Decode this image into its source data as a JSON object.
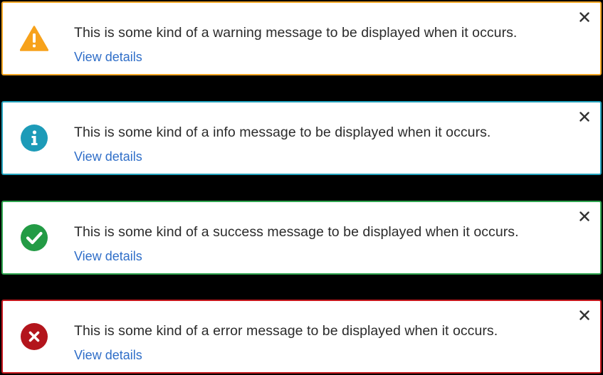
{
  "alerts": [
    {
      "type": "warning",
      "icon": "warning-triangle-icon",
      "border_color": "#f5a623",
      "icon_color": "#f7a21b",
      "message": "This is some kind of a warning message to be displayed when it occurs.",
      "link_label": "View details"
    },
    {
      "type": "info",
      "icon": "info-circle-icon",
      "border_color": "#22a2bd",
      "icon_color": "#1d9bb8",
      "message": "This is some kind of a info message to be displayed when it occurs.",
      "link_label": "View details"
    },
    {
      "type": "success",
      "icon": "check-circle-icon",
      "border_color": "#2ea44f",
      "icon_color": "#239b45",
      "message": "This is some kind of a success message to be displayed when it occurs.",
      "link_label": "View details"
    },
    {
      "type": "error",
      "icon": "error-circle-icon",
      "border_color": "#c4161c",
      "icon_color": "#b3151c",
      "message": "This is some kind of a error message to be displayed when it occurs.",
      "link_label": "View details"
    }
  ],
  "close_icon": "close-icon",
  "link_color": "#2f6ec8"
}
